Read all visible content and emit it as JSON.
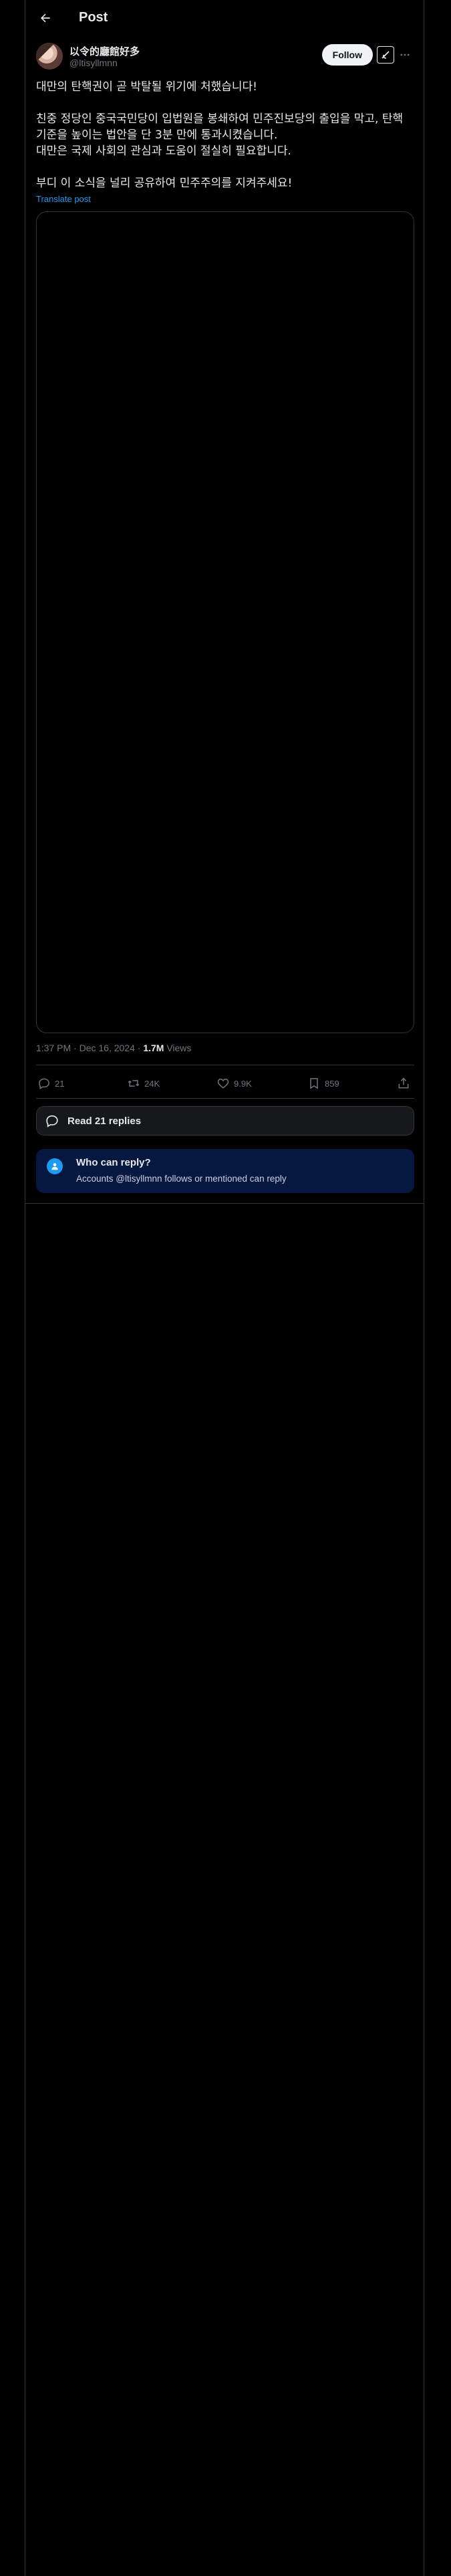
{
  "header": {
    "title": "Post"
  },
  "author": {
    "display_name": "以令的廳館好多",
    "handle": "@ltisyllmnn",
    "follow_label": "Follow"
  },
  "post": {
    "paragraphs": [
      "대만의 탄핵권이 곧 박탈될 위기에 처했습니다!",
      "친중 정당인 중국국민당이 입법원을 봉쇄하여 민주진보당의 출입을 막고, 탄핵 기준을 높이는 법안을 단 3분 만에 통과시켰습니다.",
      "대만은 국제 사회의 관심과 도움이 절실히 필요합니다.",
      "부디 이 소식을 널리 공유하여 민주주의를 지켜주세요!"
    ],
    "translate_label": "Translate post"
  },
  "meta": {
    "timestamp": "1:37 PM · Dec 16, 2024 · ",
    "views_count": "1.7M",
    "views_label": " Views"
  },
  "actions": {
    "replies": "21",
    "reposts": "24K",
    "likes": "9.9K",
    "bookmarks": "859"
  },
  "read_replies": {
    "label": "Read 21 replies"
  },
  "who_can_reply": {
    "title": "Who can reply?",
    "description": "Accounts @ltisyllmnn follows or mentioned can reply"
  },
  "colors": {
    "background": "#000000",
    "text": "#e7e9ea",
    "muted": "#71767b",
    "accent": "#1d9bf0",
    "notice_bg": "#061740"
  }
}
